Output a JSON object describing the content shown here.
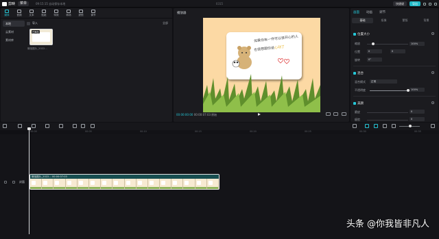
{
  "app": {
    "name": "剪映",
    "menu_label": "菜单",
    "autosave": "09:15:15 自动保存本地",
    "title": "0315"
  },
  "topbar": {
    "shortcut_label": "快捷键",
    "export_label": "导出"
  },
  "left_tabs": [
    {
      "label": "媒体",
      "icon": "media-icon"
    },
    {
      "label": "音频",
      "icon": "audio-icon"
    },
    {
      "label": "文本",
      "icon": "text-icon"
    },
    {
      "label": "贴纸",
      "icon": "sticker-icon"
    },
    {
      "label": "特效",
      "icon": "effects-icon"
    },
    {
      "label": "转场",
      "icon": "transition-icon"
    },
    {
      "label": "滤镜",
      "icon": "filter-icon"
    },
    {
      "label": "调节",
      "icon": "adjust-icon"
    }
  ],
  "sidenav": [
    {
      "label": "本地"
    },
    {
      "label": "云素材"
    },
    {
      "label": "素材库"
    }
  ],
  "media": {
    "import_label": "导入",
    "view_label": "全部",
    "thumb_badge": "已添加",
    "thumb_name": "微信图片_2022..."
  },
  "player": {
    "title": "播放器",
    "current_time": "00:00:00:00",
    "total_time": "00:00:07:03",
    "ratio_label": "原始",
    "text_line1": "如果你有一件可以很开心的人",
    "text_line2_a": "也很想跟你说",
    "text_line2_b": "心动了"
  },
  "inspector": {
    "tabs": [
      "画面",
      "动画",
      "调节"
    ],
    "subtabs": [
      "基础",
      "抠像",
      "蒙版",
      "背景"
    ],
    "sections": [
      {
        "title": "位置大小",
        "rows": [
          {
            "label": "缩放",
            "value": "100%"
          },
          {
            "label": "位置",
            "x": "0",
            "y": "0"
          },
          {
            "label": "旋转",
            "value": "0°"
          }
        ]
      },
      {
        "title": "混合",
        "rows": [
          {
            "label": "混合模式",
            "value": "正常"
          },
          {
            "label": "不透明度",
            "value": "100%"
          }
        ]
      },
      {
        "title": "美颜",
        "rows": [
          {
            "label": "磨皮",
            "value": "0"
          },
          {
            "label": "瘦脸",
            "value": "0"
          }
        ]
      }
    ]
  },
  "timeline": {
    "ruler": [
      "00:00",
      "00:05",
      "00:10",
      "00:15",
      "00:20",
      "00:25",
      "00:30",
      "00:35",
      "00:40",
      "00:45",
      "00:50",
      "00:55",
      "01:00"
    ],
    "track_label": "封面",
    "clip_label": "微信图片_2022... 00:00:07:03"
  },
  "watermark": "头条 @你我皆非凡人"
}
